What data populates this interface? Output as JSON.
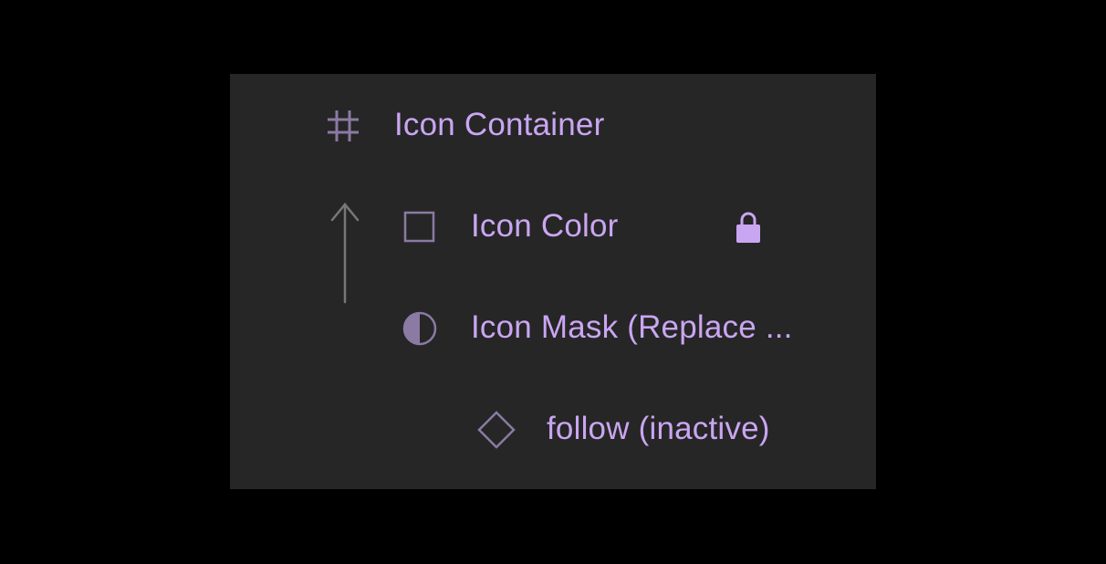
{
  "colors": {
    "background": "#000000",
    "panel": "#262626",
    "label": "#c9a6f2",
    "icon": "#8b7aa3",
    "connector": "#777777",
    "lock": "#c9a6f2"
  },
  "layers": [
    {
      "label": "Icon Container",
      "icon": "frame-icon"
    },
    {
      "label": "Icon Color",
      "icon": "rectangle-icon",
      "locked": true,
      "lock_icon": "lock-icon"
    },
    {
      "label": "Icon Mask (Replace ...",
      "icon": "mask-icon"
    },
    {
      "label": "follow (inactive)",
      "icon": "component-instance-icon"
    }
  ],
  "connector_icon": "mask-arrow-icon"
}
